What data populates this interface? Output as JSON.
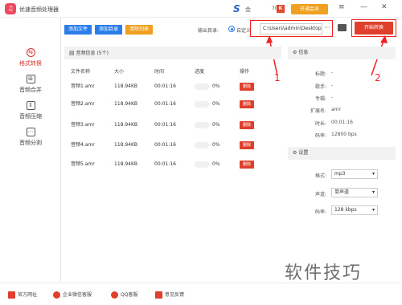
{
  "app": {
    "title": "优速音频处理器",
    "user": "金",
    "vip_count": "70",
    "open_vip": "开通会员",
    "logo_glyph": "♫"
  },
  "colors": {
    "accent": "#e0402b",
    "blue": "#2b7de9",
    "annotation": "#ee2222"
  },
  "sidebar": {
    "items": [
      {
        "label": "格式转换",
        "icon": "convert-icon",
        "glyph": "⇆"
      },
      {
        "label": "音频合并",
        "icon": "merge-icon",
        "glyph": "⊞"
      },
      {
        "label": "音频压缩",
        "icon": "compress-icon",
        "glyph": "⇕"
      },
      {
        "label": "音频分割",
        "icon": "split-icon",
        "glyph": "⋯"
      }
    ]
  },
  "toolbar": {
    "add_file": "添加文件",
    "add_dir": "添加目录",
    "clear_list": "清除列表",
    "output_label": "输出目录:",
    "custom_label": "自定义",
    "output_path": "C:\\Users\\admin\\Desktop",
    "dots": "···",
    "start": "开始转换"
  },
  "filelist": {
    "header": "音频信息 (5个)",
    "columns": [
      "文件名称",
      "大小",
      "时间",
      "进度",
      "操作"
    ],
    "rows": [
      {
        "name": "音频1.amr",
        "size": "118.94KB",
        "time": "00:01:16",
        "progress": "0%",
        "progress_value": 0,
        "action": "删除"
      },
      {
        "name": "音频2.amr",
        "size": "118.94KB",
        "time": "00:01:16",
        "progress": "0%",
        "progress_value": 0,
        "action": "删除"
      },
      {
        "name": "音频3.amr",
        "size": "118.94KB",
        "time": "00:01:16",
        "progress": "0%",
        "progress_value": 0,
        "action": "删除"
      },
      {
        "name": "音频4.amr",
        "size": "118.94KB",
        "time": "00:01:16",
        "progress": "0%",
        "progress_value": 0,
        "action": "删除"
      },
      {
        "name": "音频5.amr",
        "size": "118.94KB",
        "time": "00:01:16",
        "progress": "0%",
        "progress_value": 0,
        "action": "删除"
      }
    ]
  },
  "info": {
    "header": "信息",
    "fields": [
      {
        "label": "标题:",
        "value": "-"
      },
      {
        "label": "歌手:",
        "value": "-"
      },
      {
        "label": "专辑:",
        "value": "-"
      },
      {
        "label": "扩展名:",
        "value": "amr"
      },
      {
        "label": "时长:",
        "value": "00:01:16"
      },
      {
        "label": "码率:",
        "value": "12800 bps"
      }
    ]
  },
  "settings": {
    "header": "设置",
    "fields": [
      {
        "label": "格式:",
        "value": "mp3"
      },
      {
        "label": "声道:",
        "value": "单声道"
      },
      {
        "label": "码率:",
        "value": "128 kbps"
      }
    ]
  },
  "footer": {
    "items": [
      "官方网址",
      "企业微信客服",
      "QQ客服",
      "意见反馈"
    ]
  },
  "annotations": {
    "one": "1",
    "two": "2",
    "watermark": "软件技巧"
  }
}
